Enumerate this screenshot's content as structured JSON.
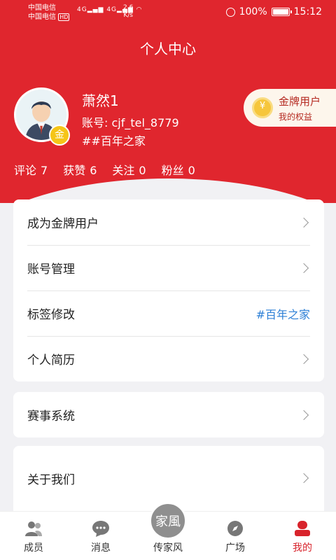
{
  "status_bar": {
    "carrier_1": "中国电信",
    "carrier_2": "中国电信",
    "hd_badge": "HD",
    "signal_text": "4G",
    "speed_value": "2.6",
    "speed_unit": "K/s",
    "battery": "100%",
    "time": "15:12"
  },
  "header": {
    "title": "个人中心"
  },
  "profile": {
    "username": "萧然1",
    "account": "账号: cjf_tel_8779",
    "tag": "##百年之家",
    "badge_char": "金"
  },
  "stats": [
    {
      "label": "评论",
      "value": "7"
    },
    {
      "label": "获赞",
      "value": "6"
    },
    {
      "label": "关注",
      "value": "0"
    },
    {
      "label": "粉丝",
      "value": "0"
    }
  ],
  "vip": {
    "title": "金牌用户",
    "subtitle": "我的权益"
  },
  "menu_card_1": [
    {
      "label": "成为金牌用户"
    },
    {
      "label": "账号管理"
    },
    {
      "label": "标签修改",
      "value": "#百年之家"
    },
    {
      "label": "个人简历"
    }
  ],
  "menu_card_2": [
    {
      "label": "赛事系统"
    }
  ],
  "menu_card_3": [
    {
      "label": "关于我们"
    }
  ],
  "bottom_nav": [
    {
      "label": "成员",
      "icon": "members-icon"
    },
    {
      "label": "消息",
      "icon": "message-icon"
    },
    {
      "label": "传家风",
      "icon": "family-tradition-icon",
      "badge": "家風"
    },
    {
      "label": "广场",
      "icon": "compass-icon"
    },
    {
      "label": "我的",
      "icon": "profile-icon",
      "active": true
    }
  ],
  "colors": {
    "brand_red": "#e0262e",
    "link_blue": "#2c7fd6",
    "gold": "#f5c518"
  }
}
